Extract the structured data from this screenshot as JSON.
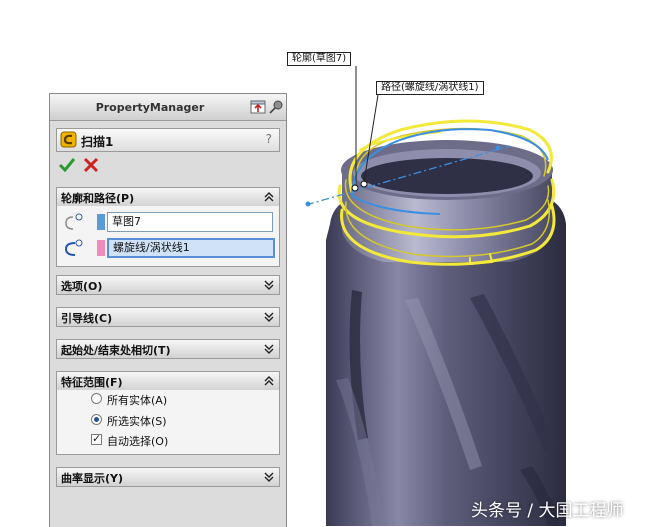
{
  "callouts": {
    "profile": "轮廓(草图7)",
    "path": "路径(螺旋线/涡状线1)"
  },
  "property_manager": {
    "title": "PropertyManager",
    "feature_name": "扫描1",
    "help": "?",
    "profile_path_section": {
      "label": "轮廓和路径(P)",
      "profile_value": "草图7",
      "path_value": "螺旋线/涡状线1",
      "profile_color": "#5b9bd5",
      "path_color": "#f08ab8"
    },
    "sections": {
      "options": "选项(O)",
      "guide_curves": "引导线(C)",
      "tangency": "起始处/结束处相切(T)",
      "feature_scope": "特征范围(F)",
      "curvature": "曲率显示(Y)"
    },
    "feature_scope": {
      "all_bodies": "所有实体(A)",
      "selected_bodies": "所选实体(S)",
      "auto_select": "自动选择(O)",
      "selected_option": "selected_bodies",
      "auto_select_checked": true
    }
  },
  "watermark": "头条号 / 大国工程师",
  "colors": {
    "body": "#4a4a66",
    "highlight_yellow": "#f2e93a",
    "selection_blue": "#3b8fe0",
    "ok_green": "#2a9a2a",
    "cancel_red": "#cc2222"
  }
}
